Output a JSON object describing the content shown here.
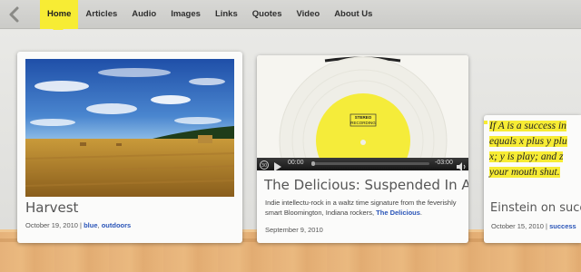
{
  "nav": {
    "items": [
      {
        "label": "Home",
        "active": true
      },
      {
        "label": "Articles"
      },
      {
        "label": "Audio"
      },
      {
        "label": "Images"
      },
      {
        "label": "Links"
      },
      {
        "label": "Quotes"
      },
      {
        "label": "Video"
      },
      {
        "label": "About Us"
      }
    ]
  },
  "cards": {
    "harvest": {
      "title": "Harvest",
      "date": "October 19, 2010 |",
      "tag1": "blue",
      "sep": ",",
      "tag2": "outdoors"
    },
    "audio": {
      "stamp_line1": "STEREO",
      "stamp_line2": "RECORDING",
      "time_elapsed": "00:00",
      "time_remaining": "-03:00",
      "title": "The Delicious: Suspended In Air",
      "desc_text": "Indie intellectu-rock in a waltz time signature from the feverishly smart Bloomington, Indiana rockers,",
      "desc_link": "The Delicious",
      "desc_end": ".",
      "date": "September 9, 2010"
    },
    "quote": {
      "line1": "If A is a success in",
      "line2": "equals x plus y plu",
      "line3": "x; y is play; and z",
      "line4": "your mouth shut.",
      "title": "Einstein on success",
      "date": "October 15, 2010 |",
      "tag": "success"
    }
  },
  "colors": {
    "accent": "#f7ec34",
    "link": "#2a55b8"
  },
  "icons": {
    "back": "chevron-left-icon",
    "play": "play-icon",
    "volume": "volume-icon",
    "rewind": "rewind-30-icon"
  }
}
